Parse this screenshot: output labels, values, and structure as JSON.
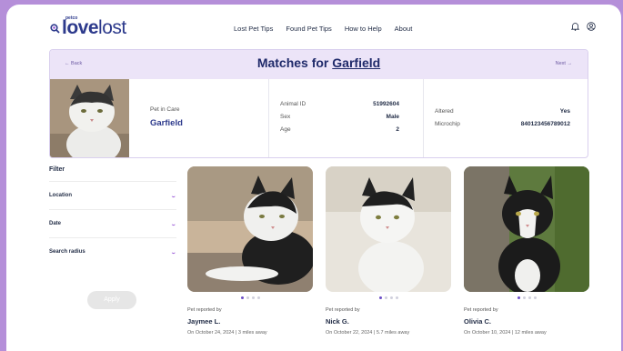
{
  "header": {
    "logo_brand": "petco",
    "logo_love": "love",
    "logo_lost": "lost",
    "nav": [
      "Lost Pet Tips",
      "Found Pet Tips",
      "How to Help",
      "About"
    ]
  },
  "match": {
    "back_label": "← Back",
    "next_label": "Next →",
    "title_prefix": "Matches for ",
    "title_name": "Garfield",
    "pet_in_care_label": "Pet in Care",
    "pet_name": "Garfield",
    "animal_id_label": "Animal ID",
    "animal_id": "51992604",
    "sex_label": "Sex",
    "sex": "Male",
    "age_label": "Age",
    "age": "2",
    "altered_label": "Altered",
    "altered": "Yes",
    "microchip_label": "Microchip",
    "microchip": "840123456789012"
  },
  "filter": {
    "title": "Filter",
    "items": [
      "Location",
      "Date",
      "Search radius"
    ],
    "apply_label": "Apply"
  },
  "cards": [
    {
      "reported_label": "Pet reported by",
      "name": "Jaymee L.",
      "meta": "On October 24, 2024  |  3 miles away"
    },
    {
      "reported_label": "Pet reported by",
      "name": "Nick G.",
      "meta": "On October 22, 2024  |  5.7 miles away"
    },
    {
      "reported_label": "Pet reported by",
      "name": "Olivia C.",
      "meta": "On October 10, 2024  |  12 miles away"
    }
  ],
  "colors": {
    "frame": "#b58fd9",
    "accent": "#2d3a8c",
    "panel_bg": "#ece4f8",
    "dot_active": "#6b4ec7"
  }
}
